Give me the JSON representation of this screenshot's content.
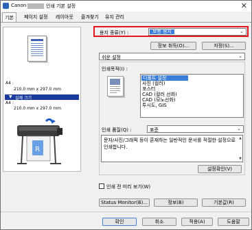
{
  "window": {
    "title_brand": "Canon",
    "title_suffix": "인쇄 기본 설정",
    "close_glyph": "✕"
  },
  "tabs": [
    "기본",
    "페이지 설정",
    "레이아웃",
    "즐겨찾기",
    "유지 관리"
  ],
  "preview": {
    "size_top_label": "A4 :",
    "size_top_dims": "210.0 mm x 297.0 mm",
    "size_mode_label": "실제 크기",
    "size_bottom_label": "A4 :",
    "size_bottom_dims": "210.0 mm x 297.0 mm"
  },
  "media": {
    "label": "용지 종류(Y) :",
    "value": "보통 용지",
    "info_button": "정보 취득(O)...",
    "detail_button": "자정(S)..."
  },
  "setting_mode": {
    "value": "쉬운 설정"
  },
  "print_target": {
    "label": "인쇄목적(I) :",
    "items": [
      "디폴트 설정",
      "사진 (컬러)",
      "포스터",
      "CAD (컬러 선화)",
      "CAD (모노선화)",
      "투시도, GIS"
    ],
    "selected_index": 0
  },
  "print_quality": {
    "label": "인쇄 품질(Q) :",
    "value": "표준",
    "description": "문자/사진/그래픽 등이 혼재하는 일반적인 문서를 적절한 설정으로 인쇄합니다.",
    "confirm_button": "설정확인(V)"
  },
  "preview_check": {
    "label": "인쇄 전 미리 보기(W)",
    "checked": false
  },
  "bottom_buttons": {
    "status_monitor": "Status Monitor(B)...",
    "info": "정보(B)",
    "defaults": "기본값(R)"
  },
  "dialog_buttons": {
    "ok": "확인",
    "cancel": "취소",
    "apply": "적용(A)",
    "help": "도움말"
  },
  "colors": {
    "highlight": "#3b7fd8",
    "callout": "#e0141a",
    "size_bar": "#1a3b9c"
  },
  "icons": {
    "app": "canon-printer-icon",
    "check": "checkbox-icon",
    "dropdown": "chevron-down-icon"
  }
}
